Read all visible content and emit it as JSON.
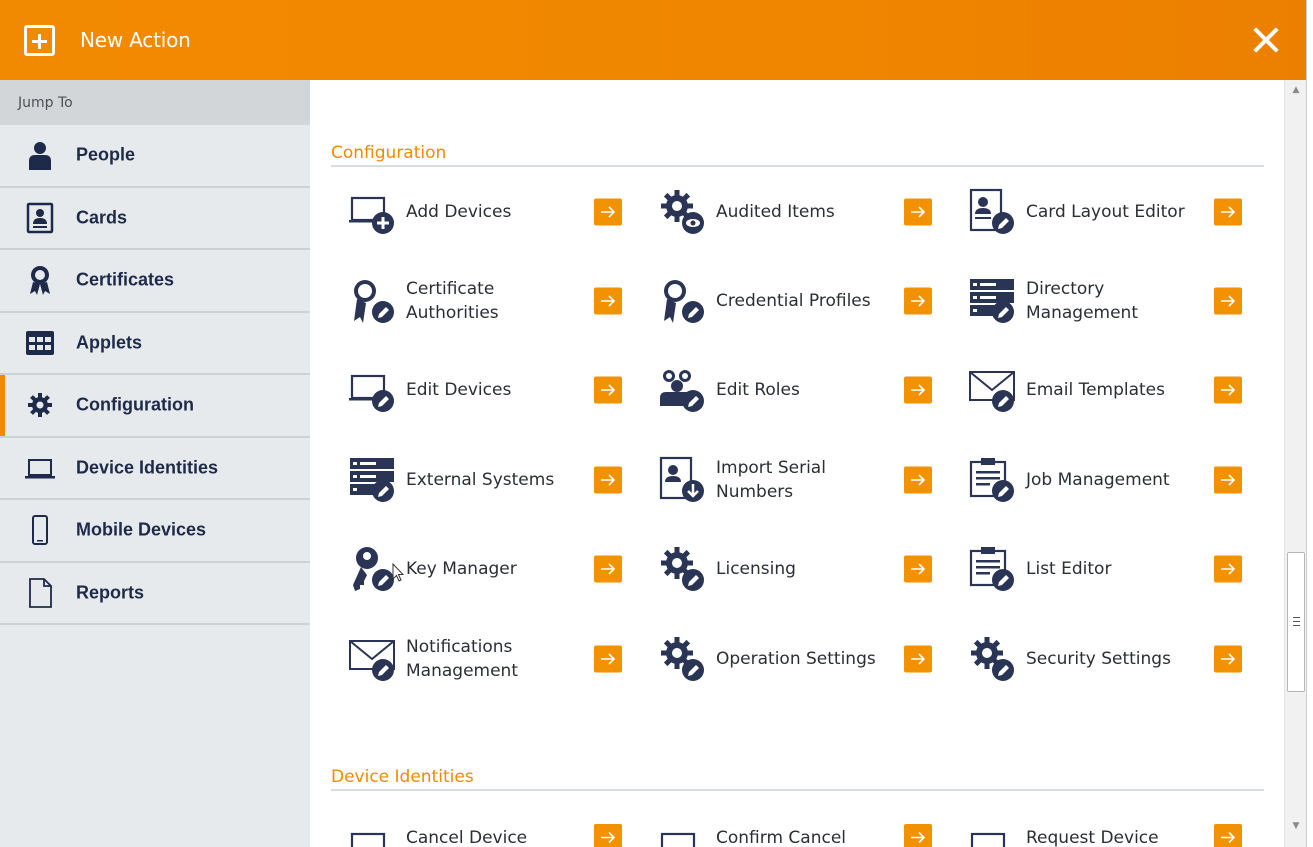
{
  "header": {
    "title": "New Action"
  },
  "sidebar": {
    "jump_label": "Jump To",
    "items": [
      {
        "label": "People",
        "icon": "person-icon"
      },
      {
        "label": "Cards",
        "icon": "card-icon"
      },
      {
        "label": "Certificates",
        "icon": "certificate-icon"
      },
      {
        "label": "Applets",
        "icon": "applets-grid-icon"
      },
      {
        "label": "Configuration",
        "icon": "gear-icon",
        "active": true
      },
      {
        "label": "Device Identities",
        "icon": "laptop-icon"
      },
      {
        "label": "Mobile Devices",
        "icon": "mobile-phone-icon"
      },
      {
        "label": "Reports",
        "icon": "document-icon"
      }
    ]
  },
  "sections": {
    "configuration": {
      "title": "Configuration",
      "tiles": [
        {
          "label": "Add Devices",
          "icon": "laptop-add-icon"
        },
        {
          "label": "Audited Items",
          "icon": "gear-eye-icon"
        },
        {
          "label": "Card Layout Editor",
          "icon": "card-edit-icon"
        },
        {
          "label": "Certificate Authorities",
          "icon": "certificate-edit-icon"
        },
        {
          "label": "Credential Profiles",
          "icon": "certificate-edit-icon"
        },
        {
          "label": "Directory Management",
          "icon": "server-edit-icon"
        },
        {
          "label": "Edit Devices",
          "icon": "laptop-edit-icon"
        },
        {
          "label": "Edit Roles",
          "icon": "group-edit-icon"
        },
        {
          "label": "Email Templates",
          "icon": "envelope-edit-icon"
        },
        {
          "label": "External Systems",
          "icon": "server-edit-icon"
        },
        {
          "label": "Import Serial Numbers",
          "icon": "card-download-icon"
        },
        {
          "label": "Job Management",
          "icon": "clipboard-edit-icon"
        },
        {
          "label": "Key Manager",
          "icon": "key-edit-icon"
        },
        {
          "label": "Licensing",
          "icon": "gear-edit-icon"
        },
        {
          "label": "List Editor",
          "icon": "clipboard-edit-icon"
        },
        {
          "label": "Notifications Management",
          "icon": "envelope-edit-icon"
        },
        {
          "label": "Operation Settings",
          "icon": "gear-edit-icon"
        },
        {
          "label": "Security Settings",
          "icon": "gear-edit-icon"
        }
      ]
    },
    "device_identities": {
      "title": "Device Identities",
      "tiles": [
        {
          "label": "Cancel Device",
          "icon": "laptop-icon"
        },
        {
          "label": "Confirm Cancel",
          "icon": "laptop-icon"
        },
        {
          "label": "Request Device",
          "icon": "laptop-icon"
        }
      ]
    }
  },
  "colors": {
    "accent": "#f28a00",
    "navy": "#1e2a4a",
    "sidebar_bg": "#e7eaec"
  }
}
